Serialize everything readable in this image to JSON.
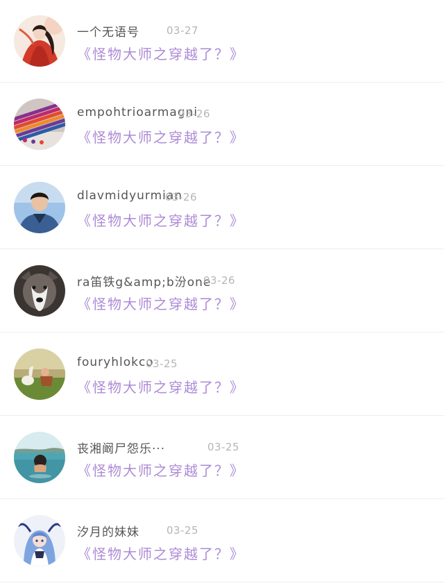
{
  "comments": [
    {
      "name": "一个无语号",
      "date": "03-27",
      "title": "《怪物大师之穿越了？》",
      "avatar_icon": "anime-woman-red-robe-avatar"
    },
    {
      "name": "empohtrioarmagni",
      "date": "03-26",
      "title": "《怪物大师之穿越了？》",
      "avatar_icon": "colored-pens-avatar"
    },
    {
      "name": "dlavmidyurmian",
      "date": "03-26",
      "title": "《怪物大师之穿越了？》",
      "avatar_icon": "young-man-portrait-avatar"
    },
    {
      "name": "ra笛铁g&amp;b汾one",
      "date": "03-26",
      "title": "《怪物大师之穿越了？》",
      "avatar_icon": "husky-dog-avatar"
    },
    {
      "name": "fouryhlokco",
      "date": "03-25",
      "title": "《怪物大师之穿越了？》",
      "avatar_icon": "child-with-goose-avatar"
    },
    {
      "name": "丧湘阚尸怨乐···",
      "date": "03-25",
      "title": "《怪物大师之穿越了？》",
      "avatar_icon": "person-in-water-avatar"
    },
    {
      "name": "汐月的妹妹",
      "date": "03-25",
      "title": "《怪物大师之穿越了？》",
      "avatar_icon": "anime-girl-blue-hair-avatar"
    }
  ],
  "colors": {
    "title_purple": "#ad8ad6",
    "name_gray": "#555555",
    "date_gray": "#b5b5b5",
    "divider": "#eeeeee"
  }
}
